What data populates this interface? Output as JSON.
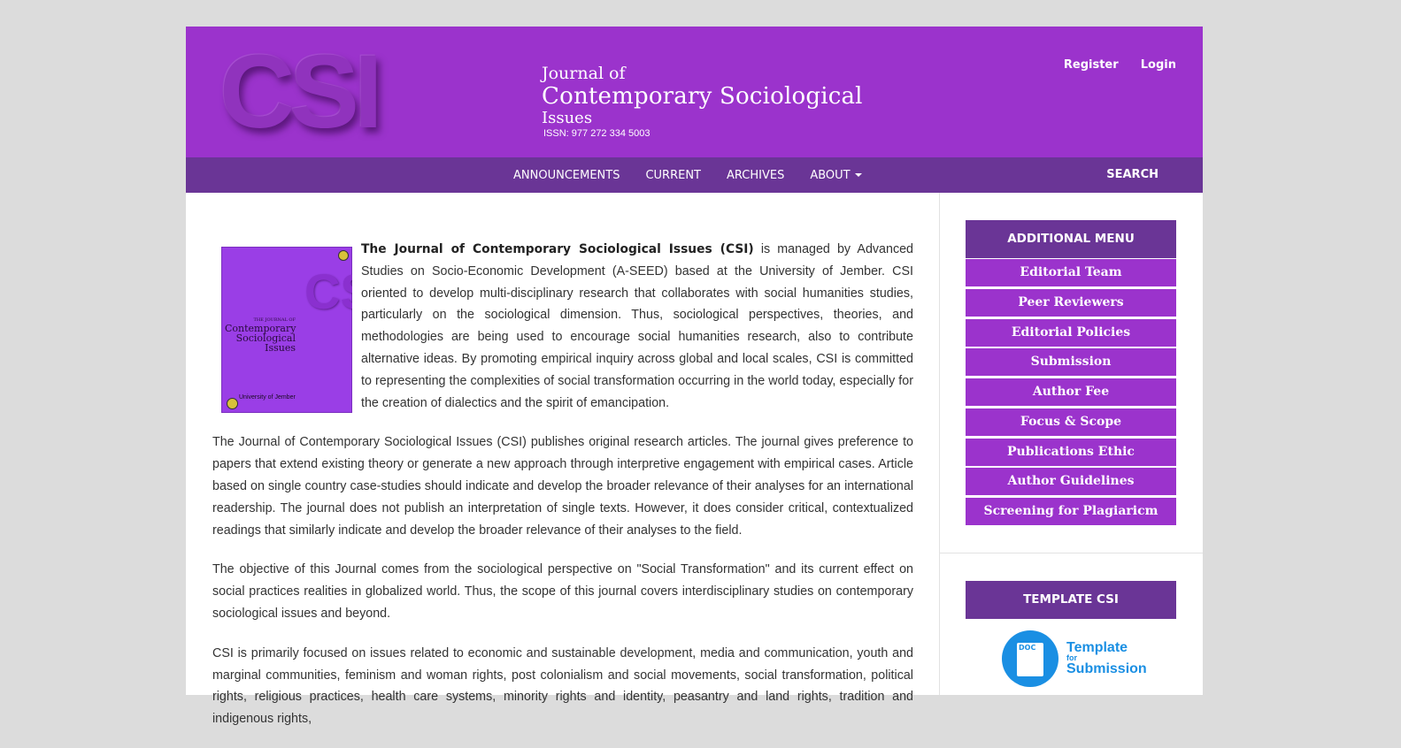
{
  "header": {
    "logo_text": "CSI",
    "journal_of": "Journal of",
    "journal_name_line1": "Contemporary Sociological",
    "journal_name_line2": "Issues",
    "issn": "ISSN: 977 272 334 5003",
    "register": "Register",
    "login": "Login"
  },
  "nav": {
    "items": [
      "ANNOUNCEMENTS",
      "CURRENT",
      "ARCHIVES",
      "ABOUT"
    ],
    "search": "SEARCH"
  },
  "cover": {
    "title_line1": "THE JOURNAL OF",
    "title_line2": "Contemporary",
    "title_line3": "Sociological",
    "title_line4": "Issues",
    "big_letters": "CSI",
    "foot": "University of Jember"
  },
  "content": {
    "intro_bold": "The Journal of Contemporary Sociological Issues (CSI)",
    "intro_rest": " is managed by Advanced Studies on Socio-Economic Development (A-SEED) based at the University of Jember. CSI oriented to develop multi-disciplinary research that collaborates with social humanities studies, particularly on the sociological dimension. Thus, sociological perspectives, theories, and methodologies are being used to encourage social humanities research, also to contribute alternative ideas. By promoting empirical inquiry across global and local scales, CSI is committed to representing the complexities of social transformation occurring in the world today, especially for the creation of dialectics and the spirit of emancipation.",
    "p2": "The Journal of Contemporary Sociological Issues (CSI) publishes original research articles. The journal gives preference to papers that extend existing theory or generate a new approach through interpretive engagement with empirical cases. Article based on single country case-studies should indicate and develop the broader relevance of their analyses for an international readership. The journal does not publish an interpretation of single texts. However, it does consider critical, contextualized readings that similarly indicate and develop the broader relevance of their analyses to the field.",
    "p3": "The objective of this Journal comes from the sociological perspective on \"Social Transformation\" and its current effect on social practices realities in globalized world. Thus, the scope of this journal covers interdisciplinary studies on contemporary sociological issues and beyond.",
    "p4": "CSI is primarily focused on issues related to economic and sustainable development, media and communication, youth and marginal communities, feminism and woman rights, post colonialism and social movements, social transformation, political rights, religious practices, health care systems, minority rights and identity, peasantry and land rights, tradition and indigenous rights,"
  },
  "sidebar": {
    "additional_menu_title": "ADDITIONAL MENU",
    "menu": [
      "Editorial Team",
      "Peer Reviewers",
      "Editorial Policies",
      "Submission",
      "Author Fee",
      "Focus & Scope",
      "Publications Ethic",
      "Author Guidelines",
      "Screening for Plagiaricm Policy"
    ],
    "template_title": "TEMPLATE CSI",
    "template_doc_label": "DOC",
    "template_line1": "Template",
    "template_line2": "for",
    "template_line3": "Submission"
  },
  "colors": {
    "header_purple": "#9b33cc",
    "nav_purple": "#6a3596",
    "template_blue": "#1a8fe3"
  }
}
